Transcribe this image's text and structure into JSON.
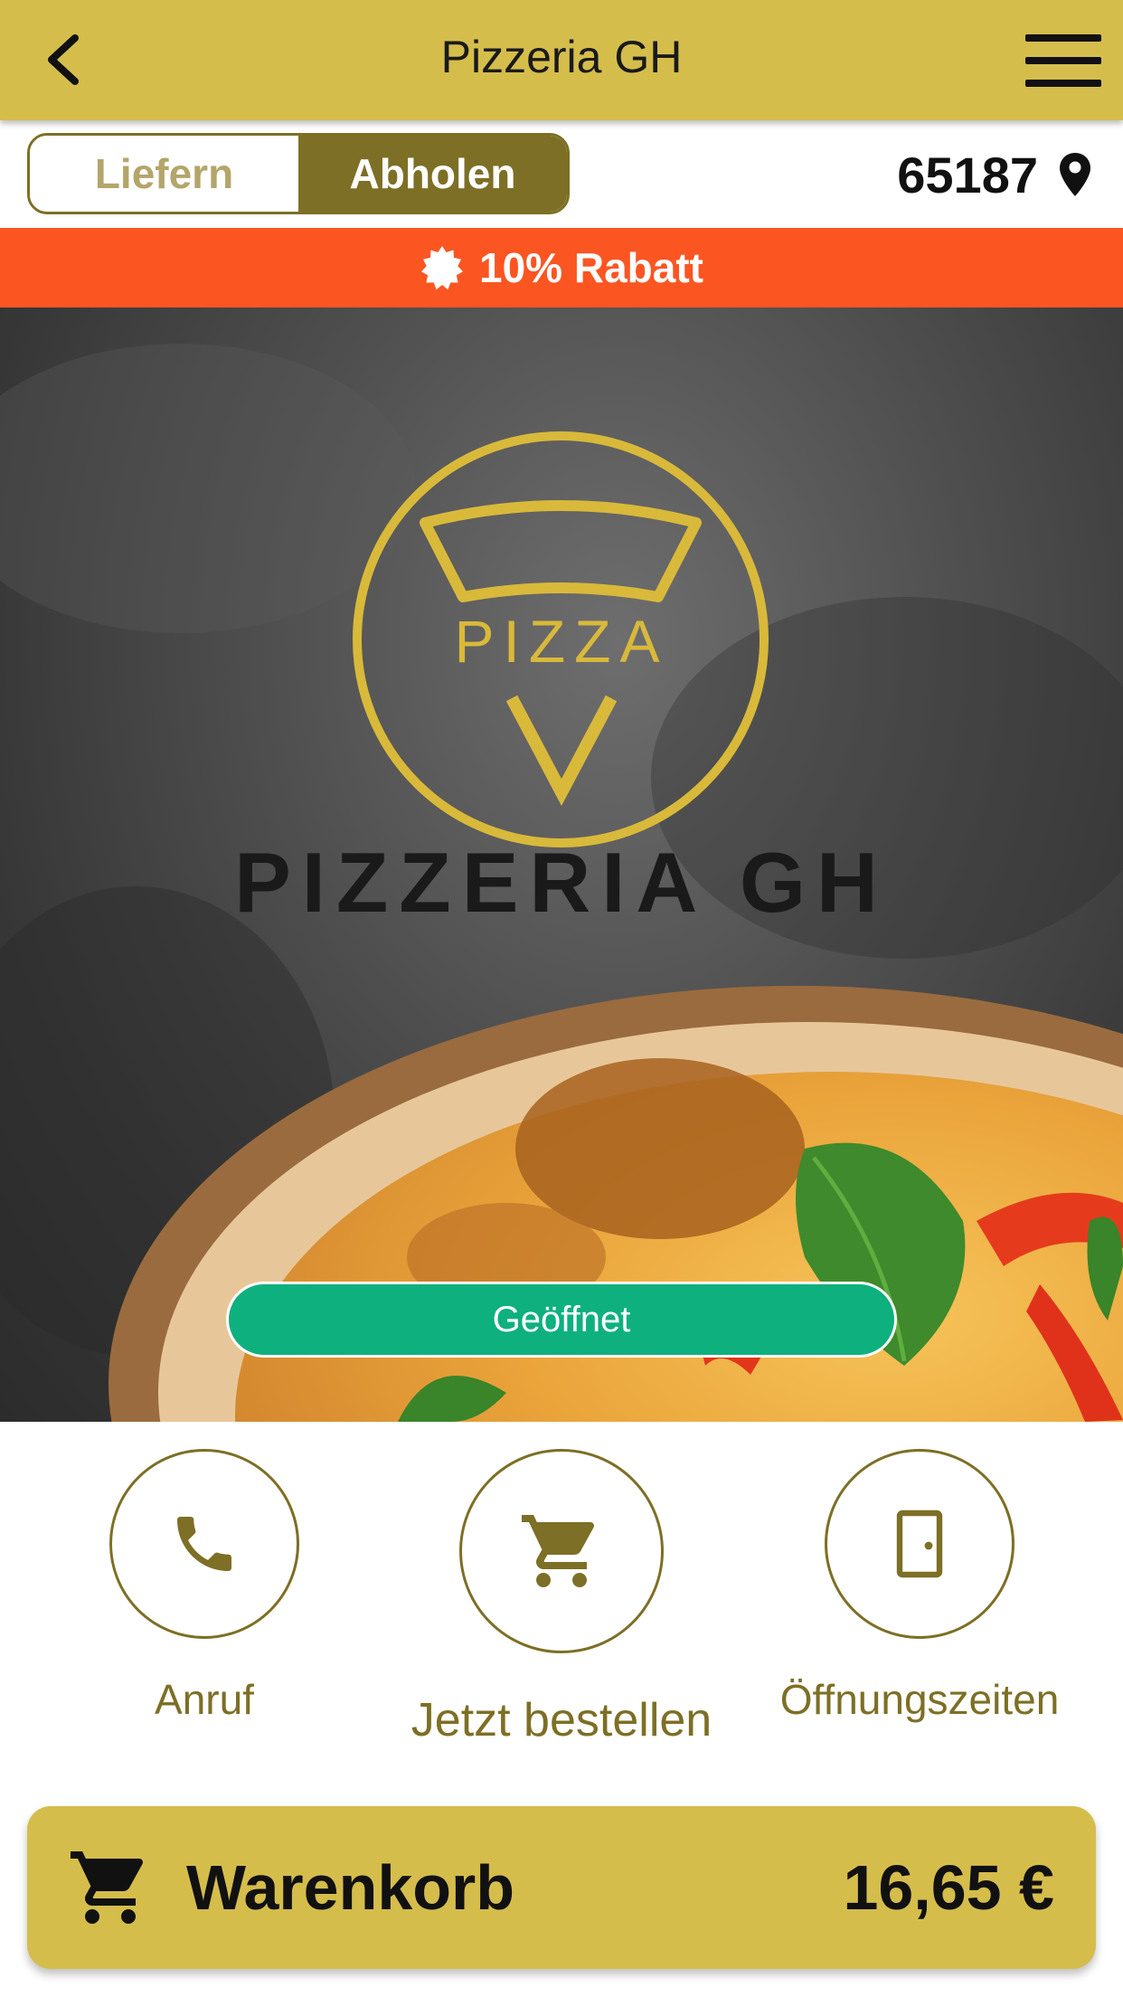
{
  "header": {
    "title": "Pizzeria GH",
    "back_icon": "chevron-left-icon",
    "menu_icon": "hamburger-menu-icon"
  },
  "mode_toggle": {
    "options": [
      {
        "label": "Liefern",
        "selected": false
      },
      {
        "label": "Abholen",
        "selected": true
      }
    ]
  },
  "location": {
    "postcode": "65187",
    "icon": "map-pin-icon"
  },
  "promo": {
    "text": "10% Rabatt",
    "icon": "badge-icon"
  },
  "hero": {
    "logo": {
      "slice_text": "PIZZA",
      "brand_text": "PIZZERIA GH"
    },
    "status": "Geöffnet"
  },
  "actions": [
    {
      "label": "Anruf",
      "icon": "phone-icon"
    },
    {
      "label": "Jetzt bestellen",
      "icon": "cart-icon"
    },
    {
      "label": "Öffnungszeiten",
      "icon": "door-icon"
    }
  ],
  "cart": {
    "label": "Warenkorb",
    "total": "16,65 €",
    "icon": "cart-icon"
  },
  "colors": {
    "brand_gold": "#d5bd4c",
    "brand_dark_gold": "#7d6f25",
    "promo_orange": "#fb5522",
    "status_green": "#0eb07e"
  }
}
